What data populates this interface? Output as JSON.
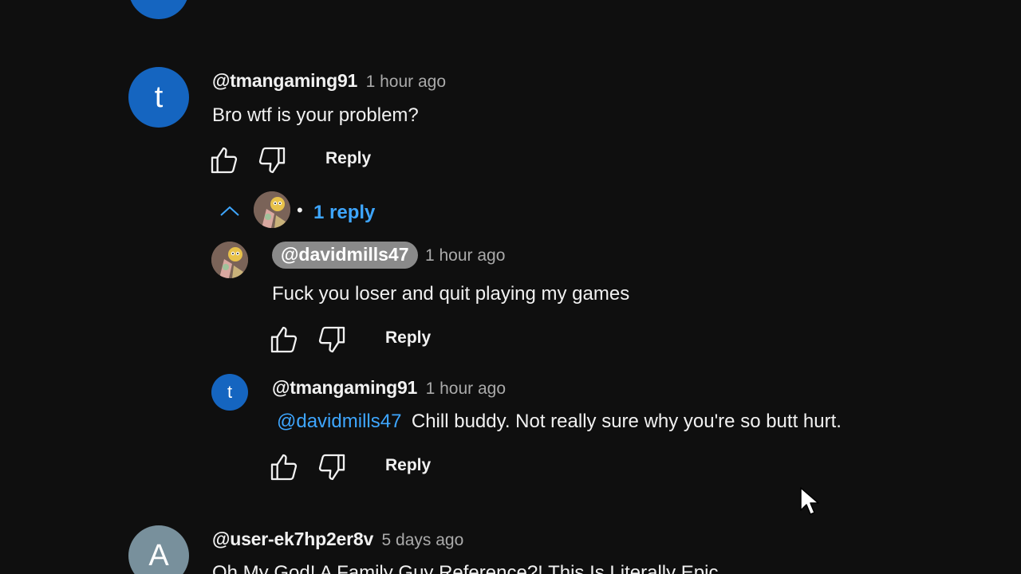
{
  "colors": {
    "background": "#0f0f0f",
    "avatar_t": "#1565c0",
    "avatar_a": "#78909c",
    "link_blue": "#3ea6ff",
    "pill_bg": "#8a8a8a"
  },
  "comments": [
    {
      "avatar_letter": "t",
      "handle": "@tmangaming91",
      "time": "1 hour ago",
      "text": "Bro wtf is your problem?",
      "reply_label": "Reply",
      "replies_toggle": {
        "icon": "chevron-up-icon",
        "separator": "•",
        "label": "1 reply"
      },
      "replies": [
        {
          "avatar_image": "cartoon-avatar",
          "handle": "@davidmills47",
          "handle_style": "highlighted-pill",
          "time": "1 hour ago",
          "text": "Fuck you loser and quit playing my games",
          "reply_label": "Reply"
        },
        {
          "avatar_letter": "t",
          "handle": "@tmangaming91",
          "time": "1 hour ago",
          "mention": "@davidmills47",
          "text": "Chill buddy. Not really sure why you're so butt hurt.",
          "reply_label": "Reply"
        }
      ]
    },
    {
      "avatar_letter": "A",
      "handle": "@user-ek7hp2er8v",
      "time": "5 days ago",
      "text": "Oh My God! A Family Guy Reference?! This Is Literally Epic"
    }
  ],
  "icons": [
    "thumbs-up-icon",
    "thumbs-down-icon",
    "chevron-up-icon",
    "mouse-cursor-icon"
  ]
}
